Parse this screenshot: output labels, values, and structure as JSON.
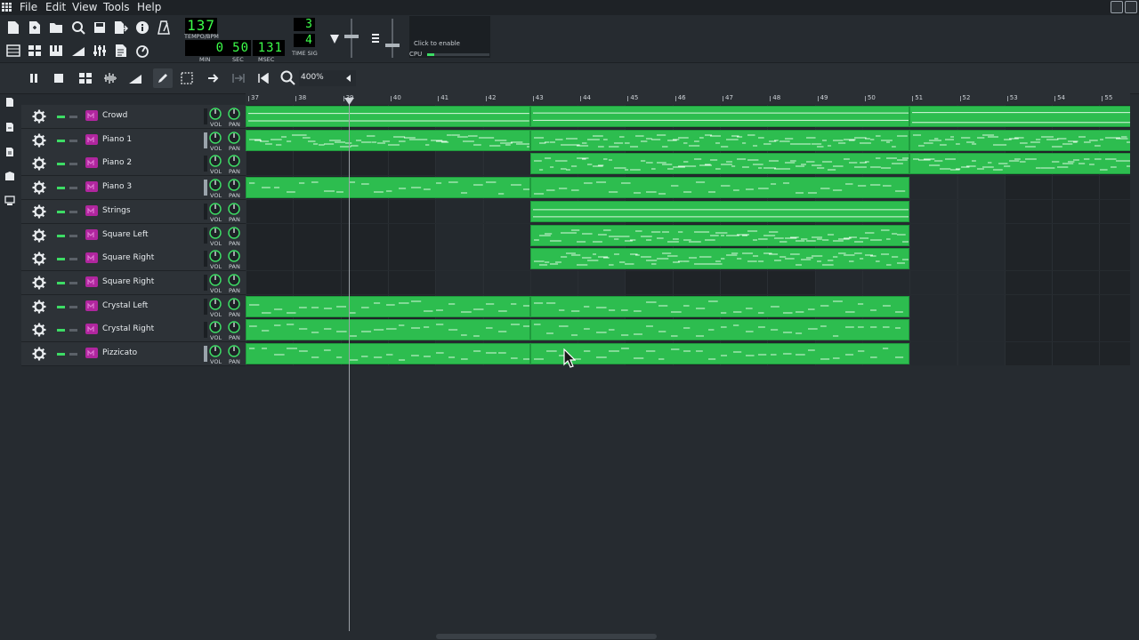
{
  "menu": {
    "file": "File",
    "edit": "Edit",
    "view": "View",
    "tools": "Tools",
    "help": "Help"
  },
  "tempo": {
    "value": "137",
    "label": "TEMPO/BPM"
  },
  "time": {
    "min": "0",
    "min_label": "MIN",
    "sec": "50",
    "sec_label": "SEC",
    "msec": "131",
    "msec_label": "MSEC"
  },
  "timesig": {
    "numerator": "3",
    "denominator": "4",
    "label": "TIME SIG"
  },
  "cpu": {
    "hint": "Click to enable",
    "label": "CPU"
  },
  "zoom": {
    "value": "400%"
  },
  "timeline": {
    "bars": [
      "37",
      "38",
      "39",
      "40",
      "41",
      "42",
      "43",
      "44",
      "45",
      "46",
      "47",
      "48",
      "49",
      "50",
      "51",
      "52",
      "53",
      "54",
      "55"
    ]
  },
  "tracks": [
    {
      "name": "Crowd",
      "vol_label": "VOL",
      "pan_label": "PAN"
    },
    {
      "name": "Piano 1",
      "vol_label": "VOL",
      "pan_label": "PAN"
    },
    {
      "name": "Piano 2",
      "vol_label": "VOL",
      "pan_label": "PAN"
    },
    {
      "name": "Piano 3",
      "vol_label": "VOL",
      "pan_label": "PAN"
    },
    {
      "name": "Strings",
      "vol_label": "VOL",
      "pan_label": "PAN"
    },
    {
      "name": "Square Left",
      "vol_label": "VOL",
      "pan_label": "PAN"
    },
    {
      "name": "Square Right",
      "vol_label": "VOL",
      "pan_label": "PAN"
    },
    {
      "name": "Square Right",
      "vol_label": "VOL",
      "pan_label": "PAN"
    },
    {
      "name": "Crystal Left",
      "vol_label": "VOL",
      "pan_label": "PAN"
    },
    {
      "name": "Crystal Right",
      "vol_label": "VOL",
      "pan_label": "PAN"
    },
    {
      "name": "Pizzicato",
      "vol_label": "VOL",
      "pan_label": "PAN"
    }
  ],
  "colors": {
    "clip": "#2dbd4f",
    "note": "#d8f7de",
    "accent": "#3ddc65",
    "instrument": "#b0269e"
  }
}
